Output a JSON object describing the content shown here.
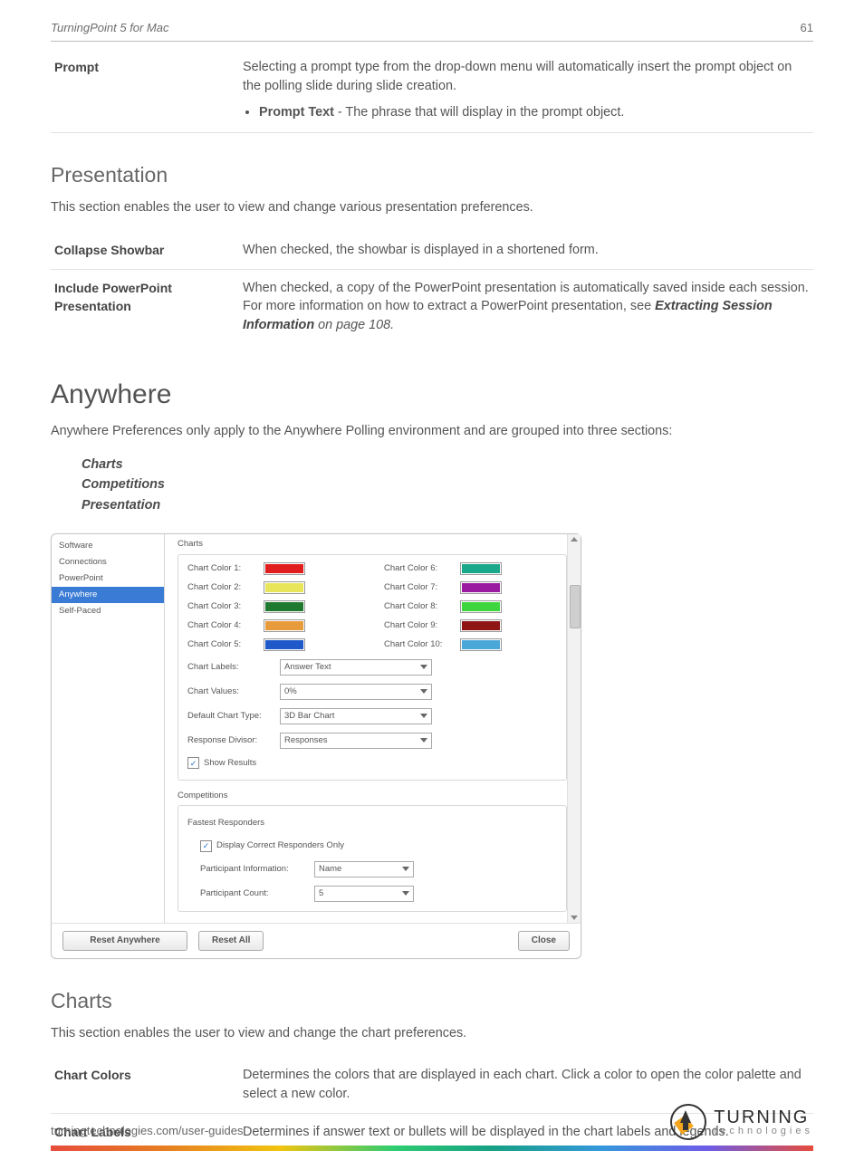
{
  "header": {
    "title": "TurningPoint 5 for Mac",
    "page": "61"
  },
  "promptRow": {
    "term": "Prompt",
    "desc_a": "Selecting a prompt type from the drop-down menu will automatically insert the prompt object on the polling slide during slide creation.",
    "bullet_label": "Prompt Text",
    "bullet_rest": " - The phrase that will display in the prompt object."
  },
  "presentation": {
    "heading": "Presentation",
    "lead": "This section enables the user to view and change various presentation preferences.",
    "rows": {
      "collapse": {
        "term": "Collapse Showbar",
        "desc": "When checked, the showbar is displayed in a shortened form."
      },
      "include": {
        "term": "Include PowerPoint Presentation",
        "desc1": "When checked, a copy of the PowerPoint presentation is automatically saved inside each session. For more information on how to extract a PowerPoint presentation, see ",
        "link": "Extracting Session Information",
        "desc2": " on page 108."
      }
    }
  },
  "anywhere": {
    "heading": "Anywhere",
    "lead": "Anywhere Preferences only apply to the Anywhere Polling environment and are grouped into three sections:",
    "links": [
      "Charts",
      "Competitions",
      "Presentation"
    ]
  },
  "prefs": {
    "sidebar": [
      "Software",
      "Connections",
      "PowerPoint",
      "Anywhere",
      "Self-Paced"
    ],
    "sidebar_selected": 3,
    "groups": {
      "charts": {
        "title": "Charts",
        "colors": [
          {
            "label": "Chart Color 1:",
            "hex": "#e11e1e"
          },
          {
            "label": "Chart Color 2:",
            "hex": "#e9e55a"
          },
          {
            "label": "Chart Color 3:",
            "hex": "#1f7a2f"
          },
          {
            "label": "Chart Color 4:",
            "hex": "#e89b3a"
          },
          {
            "label": "Chart Color 5:",
            "hex": "#1f58c8"
          },
          {
            "label": "Chart Color 6:",
            "hex": "#1aa88a"
          },
          {
            "label": "Chart Color 7:",
            "hex": "#9a1aa0"
          },
          {
            "label": "Chart Color 8:",
            "hex": "#3ed63e"
          },
          {
            "label": "Chart Color 9:",
            "hex": "#8f1414"
          },
          {
            "label": "Chart Color 10:",
            "hex": "#4aa8d8"
          }
        ],
        "labels_label": "Chart Labels:",
        "labels_value": "Answer Text",
        "values_label": "Chart Values:",
        "values_value": "0%",
        "type_label": "Default Chart Type:",
        "type_value": "3D Bar Chart",
        "divisor_label": "Response Divisor:",
        "divisor_value": "Responses",
        "show_results": "Show Results"
      },
      "competitions": {
        "title": "Competitions",
        "subtitle": "Fastest Responders",
        "display_correct": "Display Correct Responders Only",
        "pi_label": "Participant Information:",
        "pi_value": "Name",
        "pc_label": "Participant Count:",
        "pc_value": "5"
      }
    },
    "buttons": {
      "resetAnywhere": "Reset Anywhere",
      "resetAll": "Reset All",
      "close": "Close"
    }
  },
  "charts": {
    "heading": "Charts",
    "lead": "This section enables the user to view and change the chart preferences.",
    "rows": {
      "colors": {
        "term": "Chart Colors",
        "desc": "Determines the colors that are displayed in each chart. Click a color to open the color palette and select a new color."
      },
      "labels": {
        "term": "Chart Labels",
        "desc": "Determines if answer text or bullets will be displayed in the chart labels and legends."
      }
    }
  },
  "footer": {
    "url": "turningtechnologies.com/user-guides",
    "brand1": "TURNING",
    "brand2": "technologies"
  }
}
